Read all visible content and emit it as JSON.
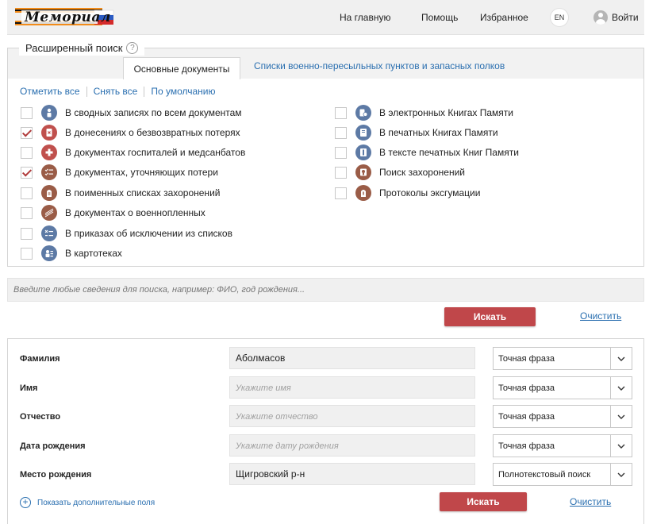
{
  "header": {
    "logo_text": "Мемориал",
    "nav": [
      "На главную",
      "Помощь",
      "Избранное"
    ],
    "lang": "EN",
    "login": "Войти"
  },
  "advanced": {
    "title": "Расширенный поиск",
    "help": "?",
    "tabs": {
      "active": "Основные документы",
      "other": "Списки военно-пересыльных пунктов и запасных полков"
    },
    "actions": {
      "check_all": "Отметить все",
      "uncheck_all": "Снять все",
      "default": "По умолчанию"
    },
    "left_docs": [
      {
        "label": "В сводных записях по всем документам",
        "checked": false,
        "icon": "person-icon",
        "color": "#5d7aa5"
      },
      {
        "label": "В донесениях о безвозвратных потерях",
        "checked": true,
        "icon": "document-cross-icon",
        "color": "#c0504d"
      },
      {
        "label": "В документах госпиталей и медсанбатов",
        "checked": false,
        "icon": "medical-cross-icon",
        "color": "#c0504d"
      },
      {
        "label": "В документах, уточняющих потери",
        "checked": true,
        "icon": "checklist-icon",
        "color": "#9a5c47"
      },
      {
        "label": "В поименных списках захоронений",
        "checked": false,
        "icon": "grave-list-icon",
        "color": "#9a5c47"
      },
      {
        "label": "В документах о военнопленных",
        "checked": false,
        "icon": "barbed-wire-icon",
        "color": "#9a5c47"
      },
      {
        "label": "В приказах об исключении из списков",
        "checked": false,
        "icon": "exclusion-list-icon",
        "color": "#5d7aa5"
      },
      {
        "label": "В картотеках",
        "checked": false,
        "icon": "card-index-icon",
        "color": "#5d7aa5"
      }
    ],
    "right_docs": [
      {
        "label": "В электронных Книгах Памяти",
        "checked": false,
        "icon": "e-book-icon",
        "color": "#5d7aa5"
      },
      {
        "label": "В печатных Книгах Памяти",
        "checked": false,
        "icon": "printed-book-icon",
        "color": "#5d7aa5"
      },
      {
        "label": "В тексте печатных Книг Памяти",
        "checked": false,
        "icon": "book-text-icon",
        "color": "#5d7aa5"
      },
      {
        "label": "Поиск захоронений",
        "checked": false,
        "icon": "burial-search-icon",
        "color": "#9a5c47"
      },
      {
        "label": "Протоколы эксгумации",
        "checked": false,
        "icon": "exhumation-icon",
        "color": "#9a5c47"
      }
    ]
  },
  "free_search": {
    "placeholder": "Введите любые сведения для поиска, например: ФИО, год рождения..."
  },
  "buttons": {
    "search": "Искать",
    "clear": "Очистить"
  },
  "form": {
    "fields": [
      {
        "label": "Фамилия",
        "value": "Аболмасов",
        "placeholder": "",
        "mode": "Точная фраза"
      },
      {
        "label": "Имя",
        "value": "",
        "placeholder": "Укажите имя",
        "mode": "Точная фраза"
      },
      {
        "label": "Отчество",
        "value": "",
        "placeholder": "Укажите отчество",
        "mode": "Точная фраза"
      },
      {
        "label": "Дата рождения",
        "value": "",
        "placeholder": "Укажите дату рождения",
        "mode": "Точная фраза"
      },
      {
        "label": "Место рождения",
        "value": "Щигровский р-н",
        "placeholder": "",
        "mode": "Полнотекстовый поиск"
      }
    ],
    "more_fields": "Показать дополнительные поля"
  }
}
